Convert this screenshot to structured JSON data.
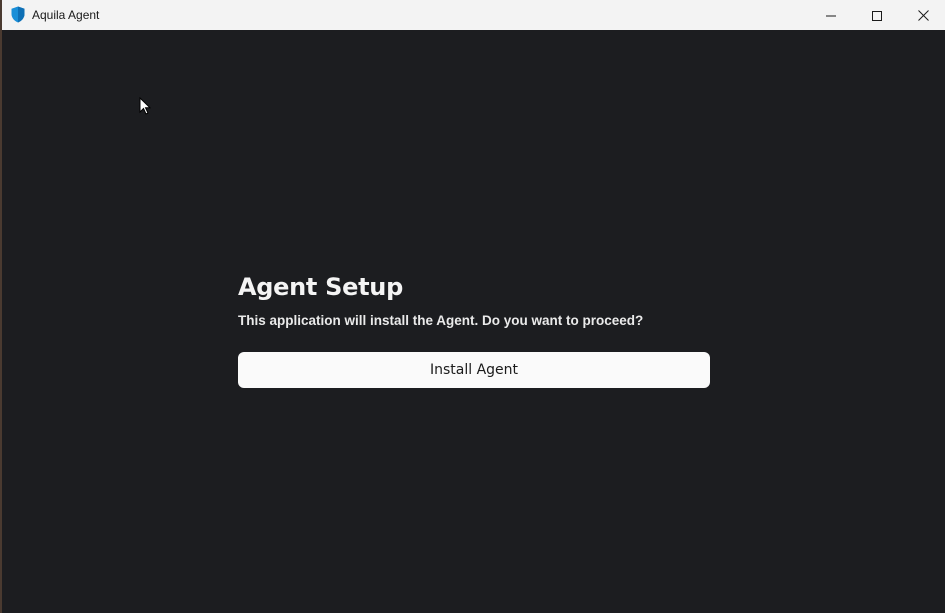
{
  "window": {
    "title": "Aquila Agent",
    "app_icon": "shield-icon",
    "controls": {
      "minimize": "minimize-icon",
      "maximize": "maximize-icon",
      "close": "close-icon"
    }
  },
  "setup": {
    "heading": "Agent Setup",
    "description": "This application will install the Agent. Do you want to proceed?",
    "install_label": "Install Agent"
  },
  "colors": {
    "background": "#1c1d20",
    "titlebar": "#f3f3f3",
    "button": "#fafafa",
    "app_icon": "#1a8fd8"
  }
}
